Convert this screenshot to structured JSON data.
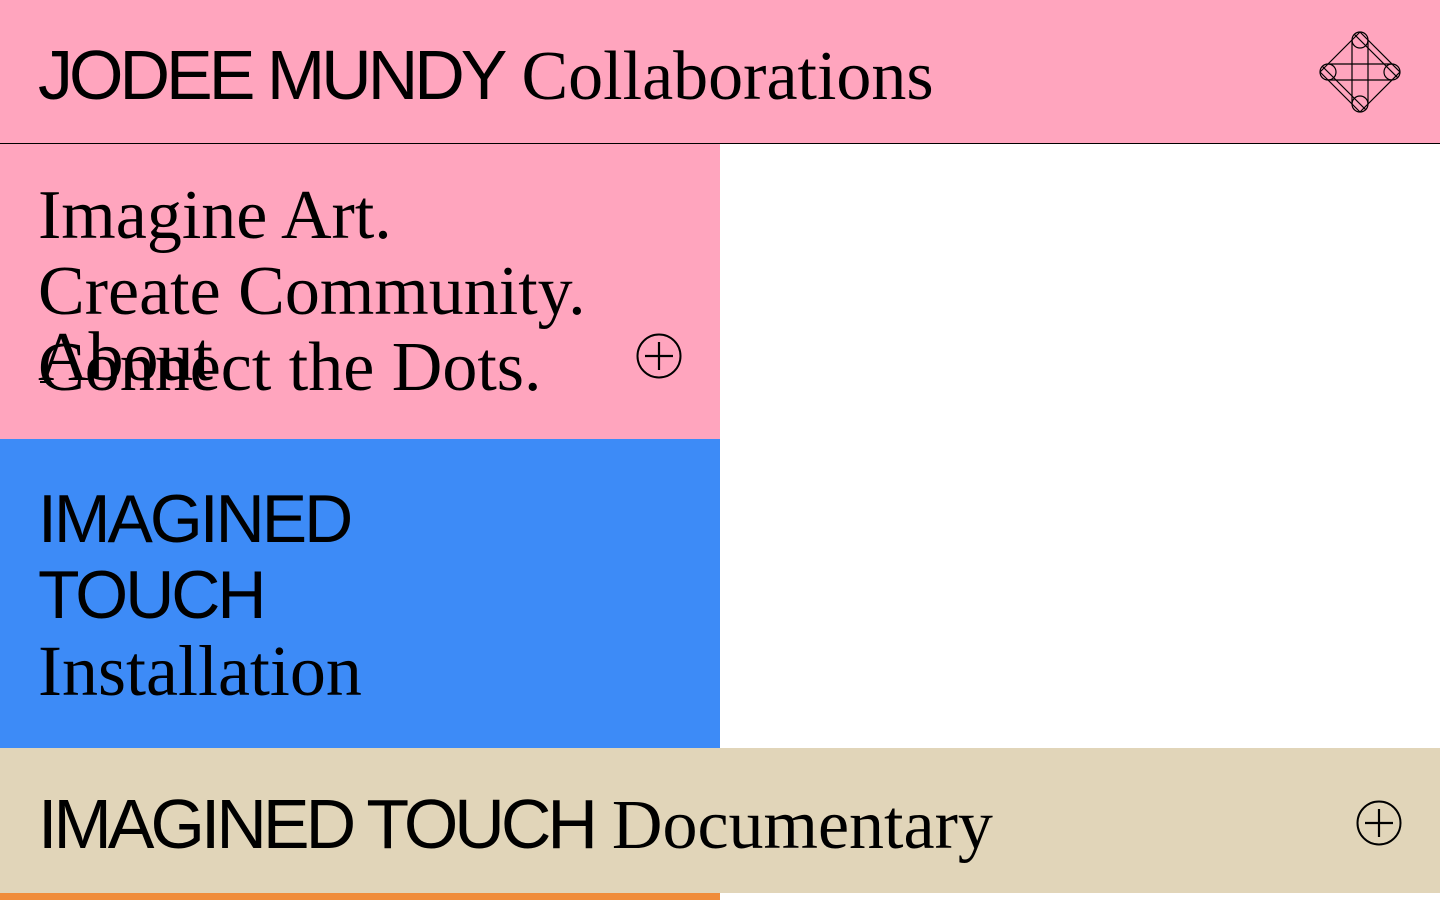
{
  "header": {
    "brand": "JODEE MUNDY",
    "subtitle": "Collaborations",
    "logo_icon": "connect-dots-logo-icon",
    "background": "#ffa5be"
  },
  "about": {
    "tagline": [
      "Imagine Art.",
      "Create Community.",
      "Connect the Dots."
    ],
    "label": "About",
    "expand_icon": "plus-circle-icon",
    "background": "#ffa5be"
  },
  "installation": {
    "lines": [
      "IMAGINED",
      "TOUCH",
      "Installation"
    ],
    "background": "#3d8bf7"
  },
  "documentary": {
    "brand": "IMAGINED TOUCH",
    "subtitle": "Documentary",
    "expand_icon": "plus-circle-icon",
    "background": "#e1d5b9"
  },
  "accent_strip": {
    "color": "#f08c3a"
  }
}
